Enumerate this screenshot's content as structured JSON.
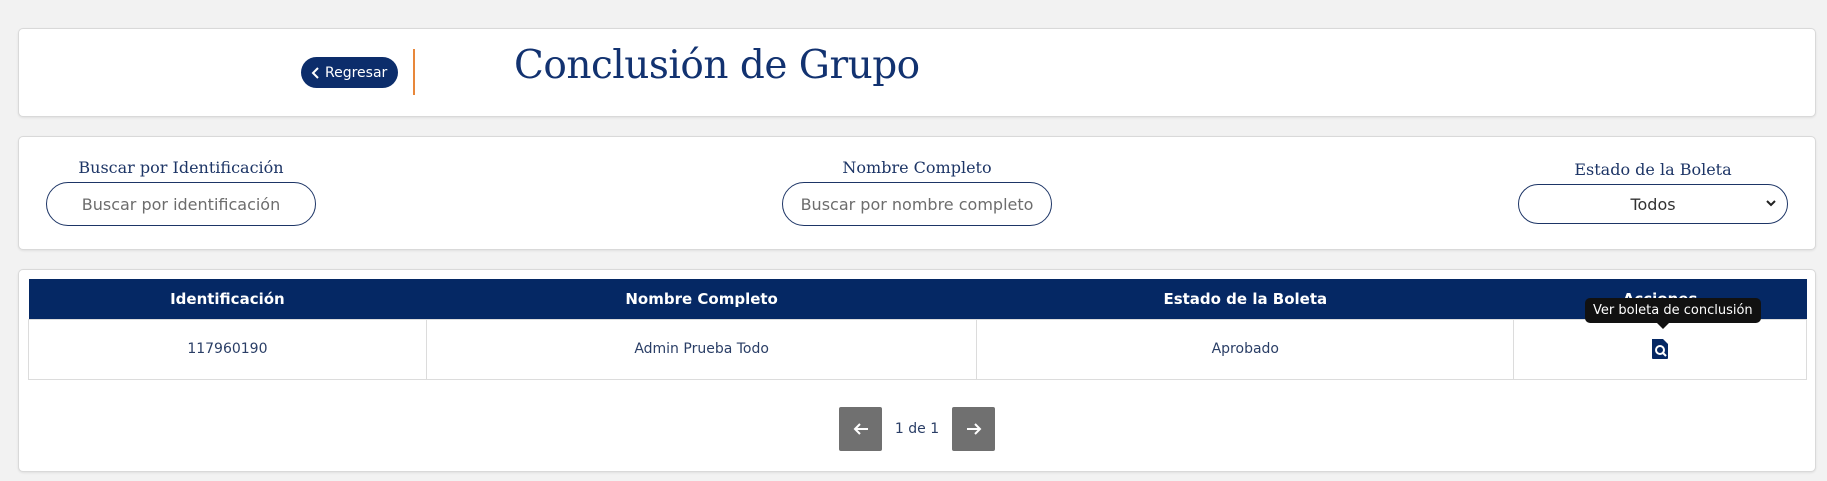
{
  "header": {
    "back_label": "Regresar",
    "title": "Conclusión de Grupo"
  },
  "filters": {
    "id_label": "Buscar por Identificación",
    "id_placeholder": "Buscar por identificación",
    "name_label": "Nombre Completo",
    "name_placeholder": "Buscar por nombre completo",
    "status_label": "Estado de la Boleta",
    "status_selected": "Todos"
  },
  "table": {
    "columns": [
      "Identificación",
      "Nombre Completo",
      "Estado de la Boleta",
      "Acciones"
    ],
    "rows": [
      {
        "id": "117960190",
        "name": "Admin Prueba Todo",
        "status": "Aprobado",
        "action_icon": "search-document-icon"
      }
    ]
  },
  "tooltip": "Ver boleta de conclusión",
  "pagination": {
    "text": "1 de 1"
  },
  "colors": {
    "primary": "#052864",
    "accent": "#e8873a",
    "pager_button": "#707070"
  }
}
